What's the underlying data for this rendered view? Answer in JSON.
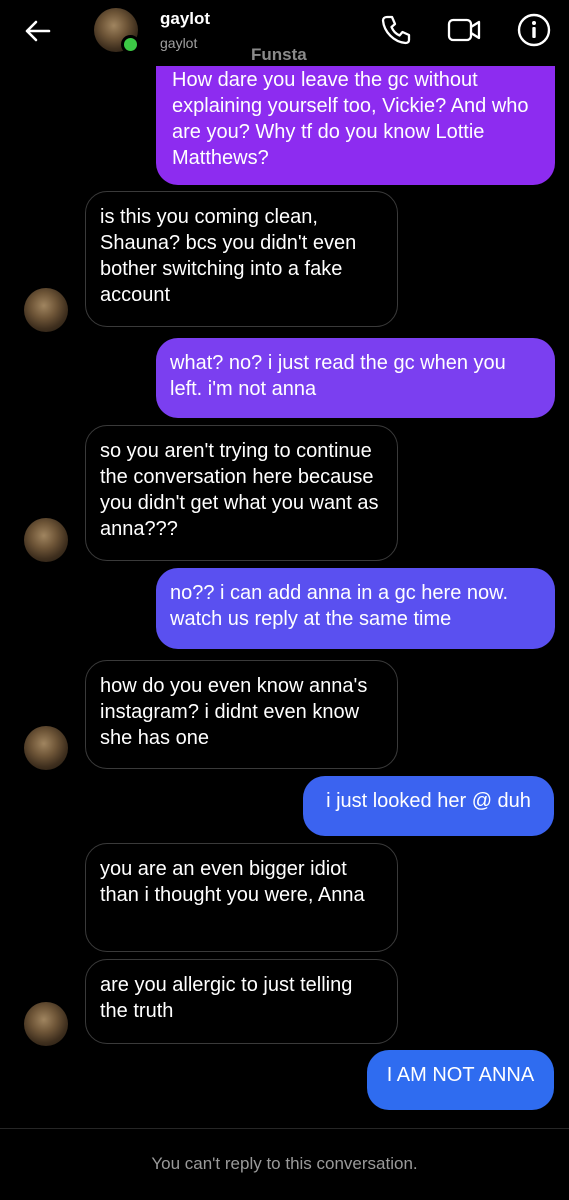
{
  "header": {
    "name": "gaylot",
    "username": "gaylot",
    "subtitle_overlay": "Funsta",
    "online_color": "#3cc945",
    "icons": [
      "back-arrow-icon",
      "phone-icon",
      "video-icon",
      "info-icon"
    ]
  },
  "messages": [
    {
      "side": "out",
      "text": "How dare you leave the gc without explaining yourself too, Vickie? And who are you? Why tf do you know Lottie Matthews?",
      "color": "#8d2cf0"
    },
    {
      "side": "in",
      "text": "is this you coming clean, Shauna? bcs you didn't even bother switching into a fake account"
    },
    {
      "side": "out",
      "text": "what? no? i just read the gc when you left. i'm not anna",
      "color": "#7b3ff0"
    },
    {
      "side": "in",
      "text": "so you aren't trying to continue the conversation here because you didn't get what you want as anna???"
    },
    {
      "side": "out",
      "text": "no?? i can add anna in a gc here now. watch us reply at the same time",
      "color": "#5a50f0"
    },
    {
      "side": "in",
      "text": "how do you even know anna's instagram? i didnt even know she has one"
    },
    {
      "side": "out",
      "text": "i just looked her @ duh",
      "color": "#3b63f0"
    },
    {
      "side": "in",
      "text": "you are an even bigger idiot than i thought you were, Anna"
    },
    {
      "side": "in",
      "text": "are you allergic to just telling the truth"
    },
    {
      "side": "out",
      "text": "I AM NOT ANNA",
      "color": "#2f6cf0"
    }
  ],
  "footer": {
    "text": "You can't reply to this conversation."
  }
}
